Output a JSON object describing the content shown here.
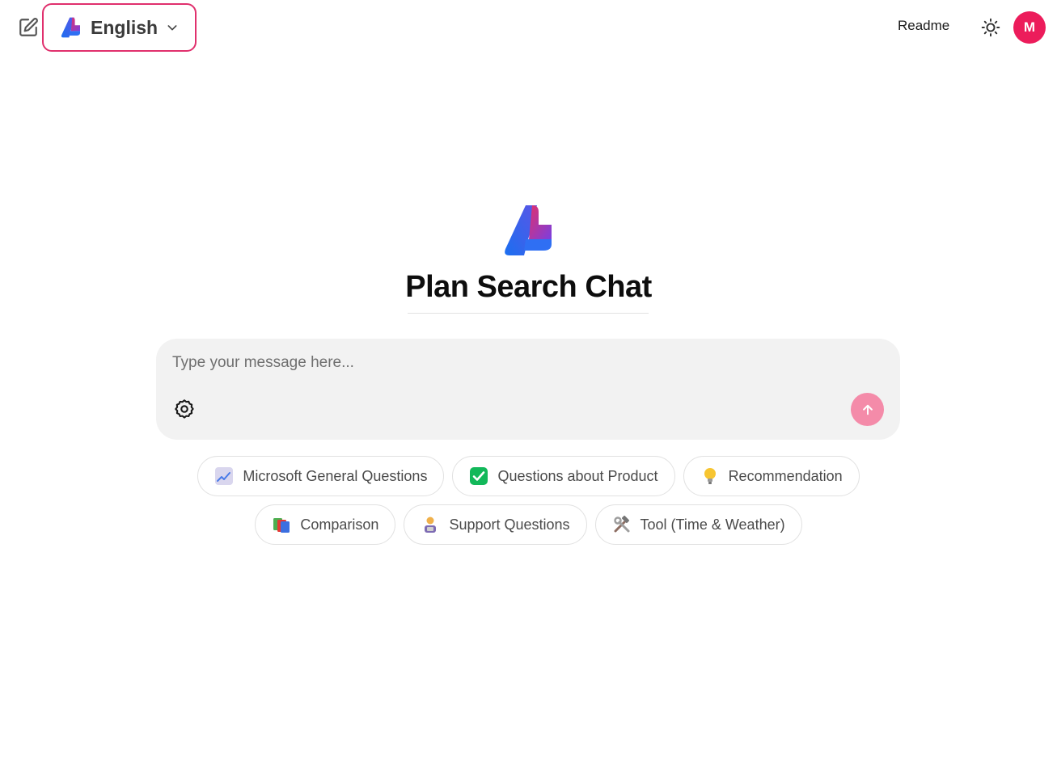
{
  "header": {
    "language": {
      "label": "English",
      "icon": "app-logo-icon"
    },
    "readme_label": "Readme",
    "theme_icon": "sun-icon",
    "avatar_initial": "M",
    "avatar_color": "#ec1c5b",
    "new_chat_icon": "edit-icon"
  },
  "hero": {
    "title": "Plan Search Chat",
    "logo_icon": "app-logo-icon"
  },
  "composer": {
    "placeholder": "Type your message here...",
    "value": "",
    "settings_icon": "gear-icon",
    "send_icon": "arrow-up-icon",
    "send_color": "#f48ba9"
  },
  "suggestions": [
    {
      "label": "Microsoft General Questions",
      "icon": "chart-increasing-icon"
    },
    {
      "label": "Questions about Product",
      "icon": "check-mark-icon"
    },
    {
      "label": "Recommendation",
      "icon": "light-bulb-icon"
    },
    {
      "label": "Comparison",
      "icon": "books-icon"
    },
    {
      "label": "Support Questions",
      "icon": "support-person-icon"
    },
    {
      "label": "Tool (Time & Weather)",
      "icon": "hammer-wrench-icon"
    }
  ],
  "colors": {
    "accent": "#e0306d",
    "composer_bg": "#f2f2f2"
  }
}
